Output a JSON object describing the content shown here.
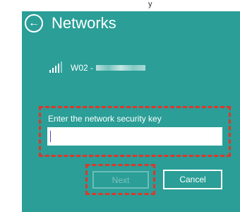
{
  "top_strip": {
    "text": "y"
  },
  "header": {
    "title": "Networks",
    "back_icon": "back-arrow-icon"
  },
  "network": {
    "name_prefix": "W02 -",
    "signal_icon": "wifi-signal-icon"
  },
  "security": {
    "label": "Enter the network security key",
    "value": ""
  },
  "buttons": {
    "next_label": "Next",
    "cancel_label": "Cancel"
  },
  "colors": {
    "charm_bg": "#2a9e97",
    "highlight": "#e0362a"
  }
}
